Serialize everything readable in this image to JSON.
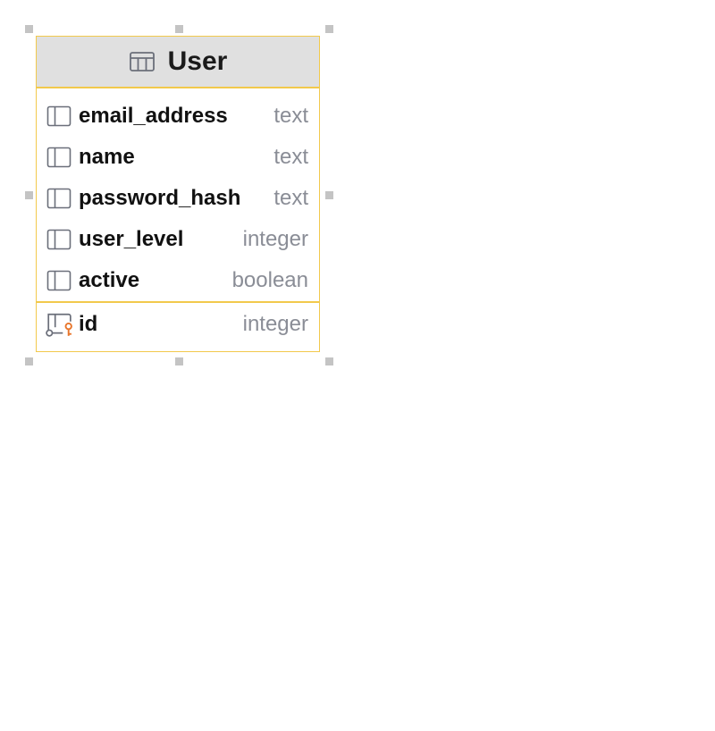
{
  "table": {
    "title": "User",
    "icon": "table-grid-icon",
    "border_color": "#f2c94c",
    "header_bg": "#e0e0e0"
  },
  "fields": [
    {
      "name": "email_address",
      "type": "text",
      "icon": "column-icon"
    },
    {
      "name": "name",
      "type": "text",
      "icon": "column-icon"
    },
    {
      "name": "password_hash",
      "type": "text",
      "icon": "column-icon"
    },
    {
      "name": "user_level",
      "type": "integer",
      "icon": "column-icon"
    },
    {
      "name": "active",
      "type": "boolean",
      "icon": "column-icon"
    }
  ],
  "primary_key": {
    "name": "id",
    "type": "integer",
    "icon": "primary-key-column-icon",
    "key_color": "#e8762c"
  }
}
